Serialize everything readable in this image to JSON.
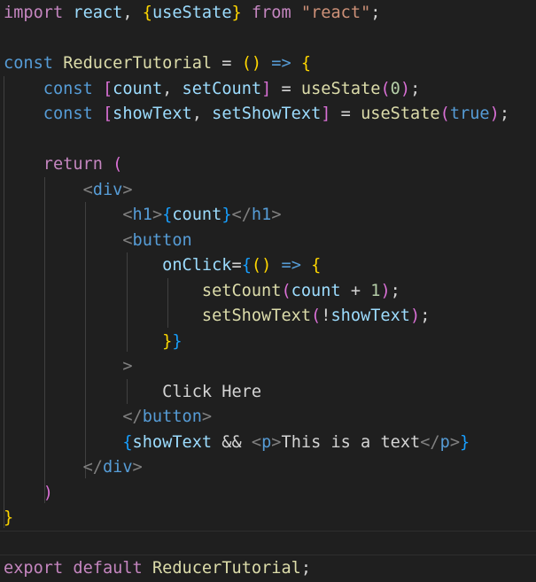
{
  "editor": {
    "language": "javascript-react",
    "bracket_colors": [
      "#ffd700",
      "#da70d6",
      "#179fff"
    ],
    "lines": [
      [
        [
          "kw",
          "import"
        ],
        [
          "txt",
          " "
        ],
        [
          "var",
          "react"
        ],
        [
          "txt",
          ", "
        ],
        [
          "b1",
          "{"
        ],
        [
          "var",
          "useState"
        ],
        [
          "b1",
          "}"
        ],
        [
          "txt",
          " "
        ],
        [
          "kw",
          "from"
        ],
        [
          "txt",
          " "
        ],
        [
          "str",
          "\"react\""
        ],
        [
          "txt",
          ";"
        ]
      ],
      [],
      [
        [
          "kb",
          "const"
        ],
        [
          "txt",
          " "
        ],
        [
          "fn",
          "ReducerTutorial"
        ],
        [
          "txt",
          " = "
        ],
        [
          "b1",
          "()"
        ],
        [
          "txt",
          " "
        ],
        [
          "kb",
          "=>"
        ],
        [
          "txt",
          " "
        ],
        [
          "b1",
          "{"
        ]
      ],
      [
        [
          "txt",
          "    "
        ],
        [
          "kb",
          "const"
        ],
        [
          "txt",
          " "
        ],
        [
          "b2",
          "["
        ],
        [
          "var",
          "count"
        ],
        [
          "txt",
          ", "
        ],
        [
          "var",
          "setCount"
        ],
        [
          "b2",
          "]"
        ],
        [
          "txt",
          " = "
        ],
        [
          "fn",
          "useState"
        ],
        [
          "b2",
          "("
        ],
        [
          "num",
          "0"
        ],
        [
          "b2",
          ")"
        ],
        [
          "txt",
          ";"
        ]
      ],
      [
        [
          "txt",
          "    "
        ],
        [
          "kb",
          "const"
        ],
        [
          "txt",
          " "
        ],
        [
          "b2",
          "["
        ],
        [
          "var",
          "showText"
        ],
        [
          "txt",
          ", "
        ],
        [
          "var",
          "setShowText"
        ],
        [
          "b2",
          "]"
        ],
        [
          "txt",
          " = "
        ],
        [
          "fn",
          "useState"
        ],
        [
          "b2",
          "("
        ],
        [
          "kb",
          "true"
        ],
        [
          "b2",
          ")"
        ],
        [
          "txt",
          ";"
        ]
      ],
      [],
      [
        [
          "txt",
          "    "
        ],
        [
          "kw",
          "return"
        ],
        [
          "txt",
          " "
        ],
        [
          "b2",
          "("
        ]
      ],
      [
        [
          "txt",
          "        "
        ],
        [
          "ang",
          "<"
        ],
        [
          "tag",
          "div"
        ],
        [
          "ang",
          ">"
        ]
      ],
      [
        [
          "txt",
          "            "
        ],
        [
          "ang",
          "<"
        ],
        [
          "tag",
          "h1"
        ],
        [
          "ang",
          ">"
        ],
        [
          "b3",
          "{"
        ],
        [
          "var",
          "count"
        ],
        [
          "b3",
          "}"
        ],
        [
          "ang",
          "</"
        ],
        [
          "tag",
          "h1"
        ],
        [
          "ang",
          ">"
        ]
      ],
      [
        [
          "txt",
          "            "
        ],
        [
          "ang",
          "<"
        ],
        [
          "tag",
          "button"
        ]
      ],
      [
        [
          "txt",
          "                "
        ],
        [
          "var",
          "onClick"
        ],
        [
          "txt",
          "="
        ],
        [
          "b3",
          "{"
        ],
        [
          "b1",
          "()"
        ],
        [
          "txt",
          " "
        ],
        [
          "kb",
          "=>"
        ],
        [
          "txt",
          " "
        ],
        [
          "b1",
          "{"
        ]
      ],
      [
        [
          "txt",
          "                    "
        ],
        [
          "fn",
          "setCount"
        ],
        [
          "b2",
          "("
        ],
        [
          "var",
          "count"
        ],
        [
          "txt",
          " + "
        ],
        [
          "num",
          "1"
        ],
        [
          "b2",
          ")"
        ],
        [
          "txt",
          ";"
        ]
      ],
      [
        [
          "txt",
          "                    "
        ],
        [
          "fn",
          "setShowText"
        ],
        [
          "b2",
          "("
        ],
        [
          "txt",
          "!"
        ],
        [
          "var",
          "showText"
        ],
        [
          "b2",
          ")"
        ],
        [
          "txt",
          ";"
        ]
      ],
      [
        [
          "txt",
          "                "
        ],
        [
          "b1",
          "}"
        ],
        [
          "b3",
          "}"
        ]
      ],
      [
        [
          "txt",
          "            "
        ],
        [
          "ang",
          ">"
        ]
      ],
      [
        [
          "txt",
          "                "
        ],
        [
          "txt",
          "Click Here"
        ]
      ],
      [
        [
          "txt",
          "            "
        ],
        [
          "ang",
          "</"
        ],
        [
          "tag",
          "button"
        ],
        [
          "ang",
          ">"
        ]
      ],
      [
        [
          "txt",
          "            "
        ],
        [
          "b3",
          "{"
        ],
        [
          "var",
          "showText"
        ],
        [
          "txt",
          " && "
        ],
        [
          "ang",
          "<"
        ],
        [
          "tag",
          "p"
        ],
        [
          "ang",
          ">"
        ],
        [
          "txt",
          "This is a text"
        ],
        [
          "ang",
          "</"
        ],
        [
          "tag",
          "p"
        ],
        [
          "ang",
          ">"
        ],
        [
          "b3",
          "}"
        ]
      ],
      [
        [
          "txt",
          "        "
        ],
        [
          "ang",
          "</"
        ],
        [
          "tag",
          "div"
        ],
        [
          "ang",
          ">"
        ]
      ],
      [
        [
          "txt",
          "    "
        ],
        [
          "b2",
          ")"
        ]
      ],
      [
        [
          "b1",
          "}"
        ]
      ],
      [],
      [
        [
          "kw",
          "export"
        ],
        [
          "txt",
          " "
        ],
        [
          "kw",
          "default"
        ],
        [
          "txt",
          " "
        ],
        [
          "fn",
          "ReducerTutorial"
        ],
        [
          "txt",
          ";"
        ]
      ]
    ]
  }
}
